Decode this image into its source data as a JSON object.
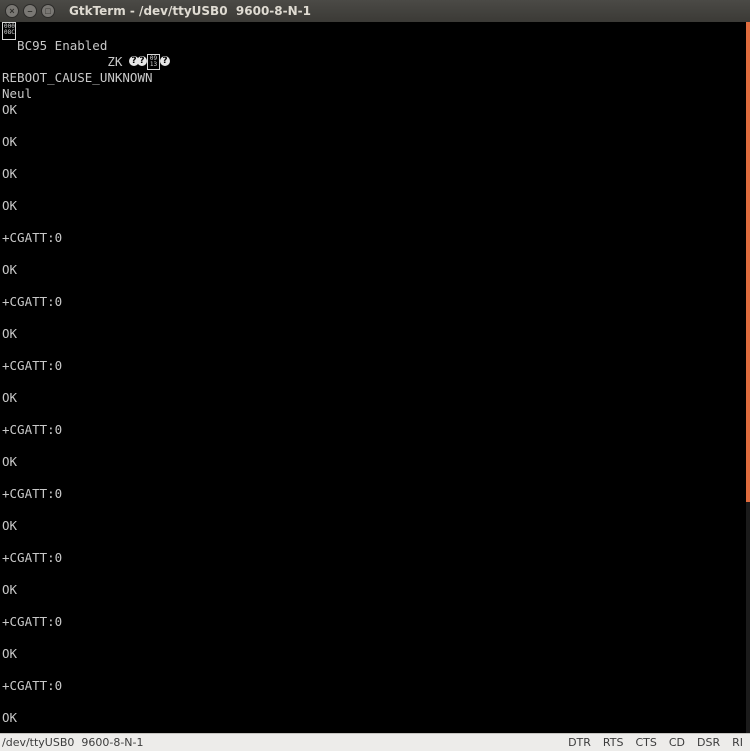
{
  "window": {
    "title": "GtkTerm - /dev/ttyUSB0  9600-8-N-1"
  },
  "terminal": {
    "garbled_glyph_1": "000\n08C",
    "garbled_glyph_2": "09\n13",
    "garbled_glyph_3": "?",
    "garbled_glyph_4": "?",
    "garbled_glyph_5": "?",
    "lines": [
      "  BC95 Enabled",
      "              ZK",
      "REBOOT_CAUSE_UNKNOWN",
      "Neul",
      "OK",
      "OK",
      "OK",
      "OK",
      "+CGATT:0",
      "OK",
      "+CGATT:0",
      "OK",
      "+CGATT:0",
      "OK",
      "+CGATT:0",
      "OK",
      "+CGATT:0",
      "OK",
      "+CGATT:0",
      "OK",
      "+CGATT:0",
      "OK",
      "+CGATT:0",
      "OK"
    ]
  },
  "statusbar": {
    "port_info": "/dev/ttyUSB0  9600-8-N-1",
    "signals": [
      "DTR",
      "RTS",
      "CTS",
      "CD",
      "DSR",
      "RI"
    ]
  },
  "colors": {
    "terminal_bg": "#000000",
    "terminal_fg": "#c8c8c8",
    "scrollbar_accent": "#e06c3f",
    "titlebar_bg": "#3f3e3a"
  }
}
